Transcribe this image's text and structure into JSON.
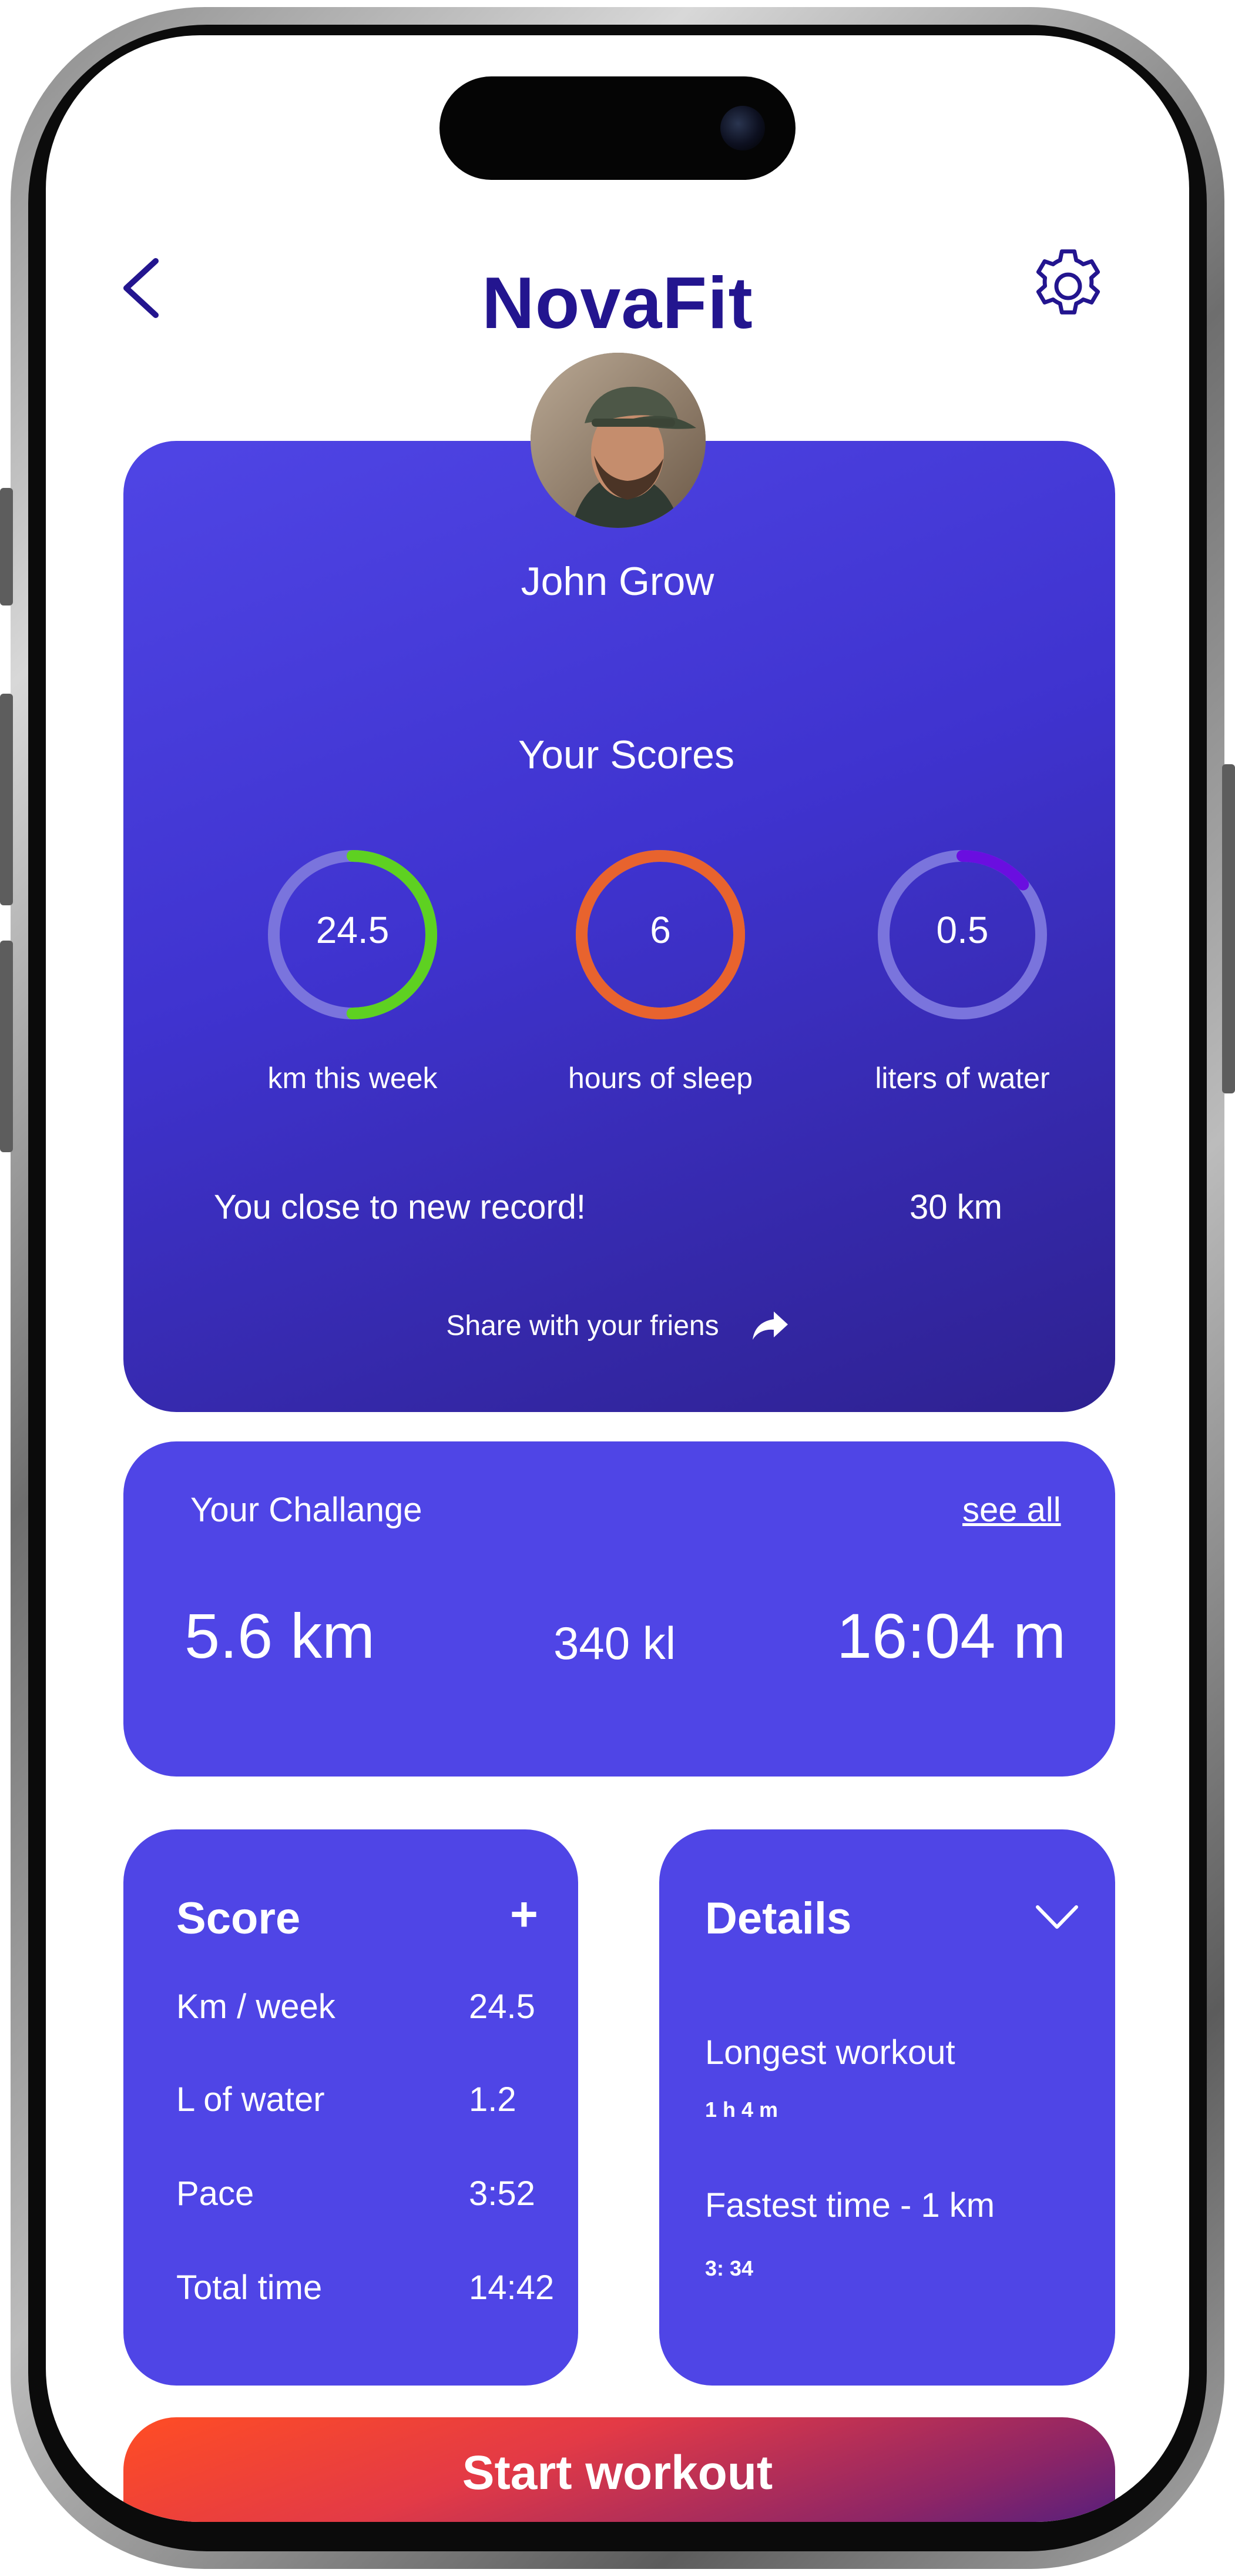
{
  "header": {
    "title": "NovaFit",
    "back_icon": "chevron-left-icon",
    "settings_icon": "gear-icon"
  },
  "profile": {
    "name": "John Grow",
    "avatar": "user-photo"
  },
  "scores": {
    "title": "Your Scores",
    "rings": [
      {
        "value": "24.5",
        "label": "km this week",
        "progress": 0.5,
        "color": "#5ed121"
      },
      {
        "value": "6",
        "label": "hours of sleep",
        "progress": 1.0,
        "color": "#e8632e"
      },
      {
        "value": "0.5",
        "label": "liters of water",
        "progress": 0.14,
        "color": "#6a0ee0"
      }
    ],
    "record_text": "You close to new record!",
    "record_value": "30 km",
    "share_text": "Share with your friens",
    "share_icon": "share-arrow-icon"
  },
  "challenge": {
    "title": "Your Challange",
    "see_all": "see all",
    "distance": "5.6 km",
    "calories": "340 kl",
    "time": "16:04 m"
  },
  "score_card": {
    "title": "Score",
    "add_label": "+",
    "rows": [
      {
        "label": "Km / week",
        "value": "24.5"
      },
      {
        "label": "L of water",
        "value": "1.2"
      },
      {
        "label": "Pace",
        "value": "3:52"
      },
      {
        "label": "Total time",
        "value": "14:42"
      }
    ]
  },
  "details_card": {
    "title": "Details",
    "chevron_icon": "chevron-down-icon",
    "items": [
      {
        "label": "Longest workout",
        "value": "1 h 4 m"
      },
      {
        "label": "Fastest time - 1 km",
        "value": "3: 34"
      }
    ]
  },
  "start_button": {
    "label": "Start workout"
  },
  "colors": {
    "brand_title": "#23158f",
    "card": "#4f45e6",
    "ring_track": "#7a74dd"
  }
}
